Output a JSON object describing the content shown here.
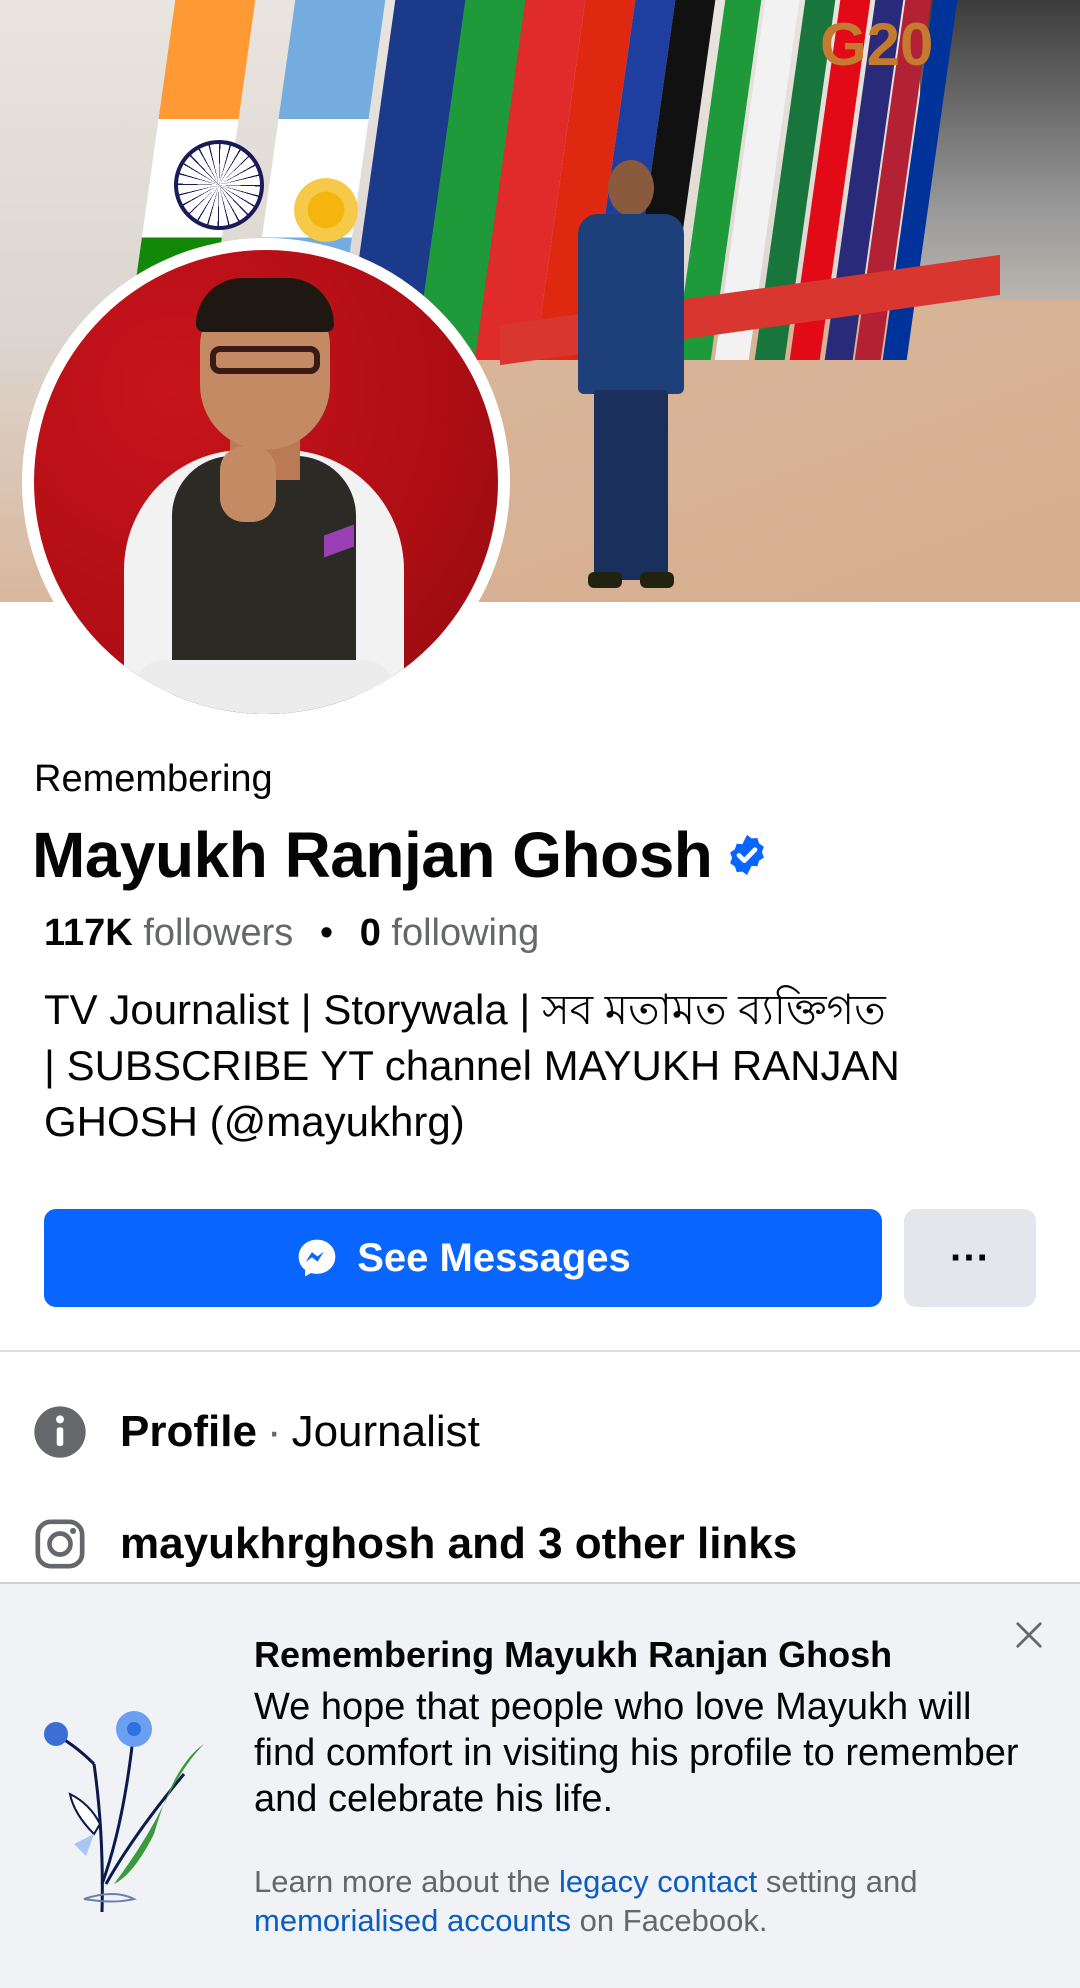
{
  "profile": {
    "status_label": "Remembering",
    "name": "Mayukh Ranjan Ghosh",
    "followers_count": "117K",
    "followers_label": "followers",
    "separator": "•",
    "following_count": "0",
    "following_label": "following",
    "bio_line1": "TV Journalist | Storywala | সব মতামত ব্যক্তিগত",
    "bio_line2": "| SUBSCRIBE YT channel MAYUKH RANJAN",
    "bio_line3": "GHOSH (@mayukhrg)"
  },
  "cover": {
    "sign_text": "G20"
  },
  "actions": {
    "primary_label": "See Messages",
    "more_label": "···"
  },
  "details": {
    "profile_label": "Profile",
    "profile_separator": "·",
    "profile_category": "Journalist",
    "links_text": "mayukhrghosh and 3 other links"
  },
  "memorial": {
    "title": "Remembering Mayukh Ranjan Ghosh",
    "body": "We hope that people who love Mayukh will find comfort in visiting his profile to remember and celebrate his life.",
    "footer_prefix": "Learn more about the ",
    "footer_link1": "legacy contact",
    "footer_mid": " setting and",
    "footer_link2": "memorialised accounts",
    "footer_suffix": " on Facebook."
  },
  "colors": {
    "accent": "#0866ff",
    "verified": "#0866ff",
    "link": "#0a5dc2",
    "secondary_text": "#65676b",
    "card_bg": "#f0f2f5"
  },
  "icons": {
    "verified": "verified-badge-icon",
    "messenger": "messenger-icon",
    "info": "info-icon",
    "instagram": "instagram-icon",
    "close": "close-icon",
    "flower": "flower-illustration"
  }
}
